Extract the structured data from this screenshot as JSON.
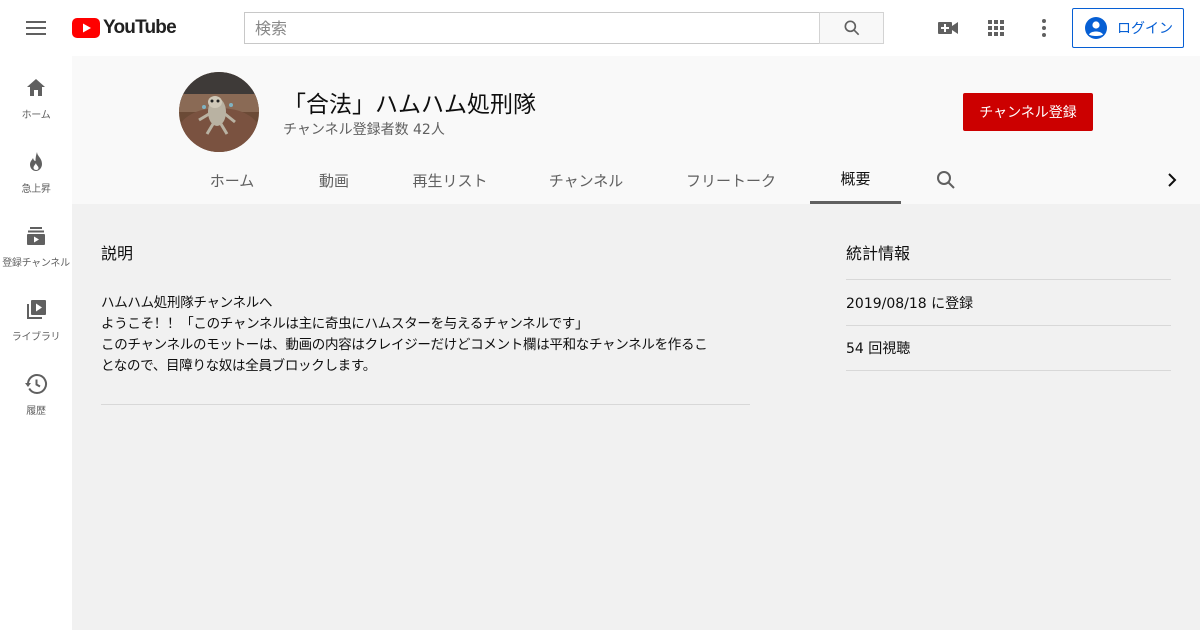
{
  "masthead": {
    "logo_text": "YouTube",
    "search_placeholder": "検索",
    "login_label": "ログイン",
    "icons": [
      "menu-icon",
      "create-video-icon",
      "apps-icon",
      "more-vert-icon",
      "account-icon",
      "search-icon"
    ]
  },
  "sidebar": {
    "items": [
      {
        "label": "ホーム",
        "icon": "home-icon"
      },
      {
        "label": "急上昇",
        "icon": "trending-icon"
      },
      {
        "label": "登録チャンネル",
        "icon": "subscriptions-icon"
      },
      {
        "label": "ライブラリ",
        "icon": "library-icon"
      },
      {
        "label": "履歴",
        "icon": "history-icon"
      }
    ]
  },
  "channel": {
    "name": "「合法」ハムハム処刑隊",
    "subscribers": "チャンネル登録者数 42人",
    "subscribe_label": "チャンネル登録",
    "tabs": [
      {
        "label": "ホーム",
        "active": false
      },
      {
        "label": "動画",
        "active": false
      },
      {
        "label": "再生リスト",
        "active": false
      },
      {
        "label": "チャンネル",
        "active": false
      },
      {
        "label": "フリートーク",
        "active": false
      },
      {
        "label": "概要",
        "active": true
      }
    ]
  },
  "about": {
    "description_title": "説明",
    "description_lines": [
      "ハムハム処刑隊チャンネルへ",
      "ようこそ！！「このチャンネルは主に奇虫にハムスターを与えるチャンネルです」",
      "このチャンネルのモットーは、動画の内容はクレイジーだけどコメント欄は平和なチャンネルを作るこ",
      "となので、目障りな奴は全員ブロックします。"
    ],
    "stats_title": "統計情報",
    "stats": [
      "2019/08/18 に登録",
      "54 回視聴"
    ]
  },
  "colors": {
    "brand_red": "#ff0000",
    "subscribe_red": "#cc0000",
    "link_blue": "#065fd4"
  }
}
